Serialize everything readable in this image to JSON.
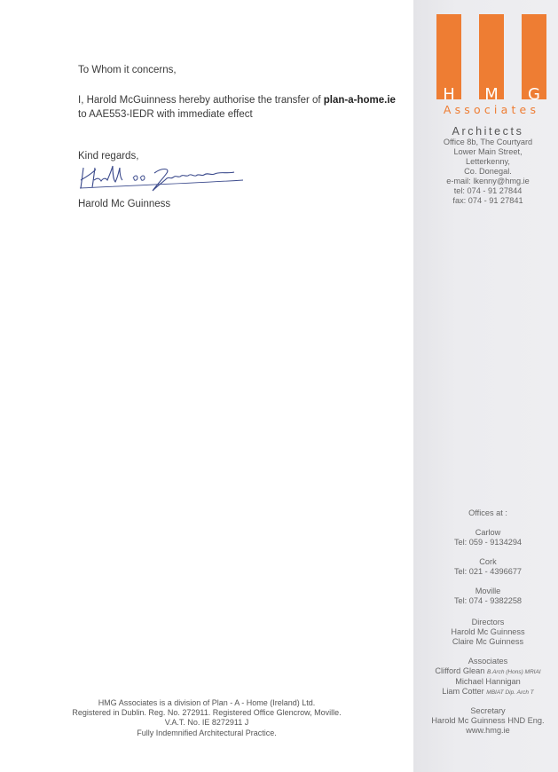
{
  "letter": {
    "greeting": "To Whom it concerns,",
    "line1_prefix": "I, Harold McGuinness hereby authorise the transfer of ",
    "line1_domain": "plan-a-home.ie",
    "line2": "to AAE553-IEDR with immediate effect",
    "closing": "Kind regards,",
    "signature_name": "Harold Mc Guinness"
  },
  "footer": {
    "lines": [
      "HMG Associates is a division of Plan - A - Home (Ireland) Ltd.",
      "Registered in Dublin. Reg. No. 272911. Registered Office Glencrow, Moville.",
      "V.A.T. No. IE 8272911 J",
      "Fully Indemnified Architectural Practice."
    ]
  },
  "logo": {
    "letters": [
      "H",
      "M",
      "G"
    ],
    "subtitle": "Associates",
    "brand_color": "#ee7d33"
  },
  "sidebar": {
    "title": "Architects",
    "address": [
      "Office 8b, The Courtyard",
      "Lower Main Street,",
      "Letterkenny,",
      "Co. Donegal."
    ],
    "email": "e-mail: lkenny@hmg.ie",
    "tel": "tel: 074 - 91 27844",
    "fax": "fax: 074 - 91 27841",
    "offices_heading": "Offices at :",
    "offices": [
      {
        "name": "Carlow",
        "tel": "Tel: 059 - 9134294"
      },
      {
        "name": "Cork",
        "tel": "Tel: 021 - 4396677"
      },
      {
        "name": "Moville",
        "tel": "Tel: 074 - 9382258"
      }
    ],
    "directors_heading": "Directors",
    "directors": [
      "Harold Mc Guinness",
      "Claire Mc Guinness"
    ],
    "associates_heading": "Associates",
    "associates": [
      {
        "name": "Clifford Glean",
        "quals": "B.Arch (Hons) MRIAI"
      },
      {
        "name": "Michael Hannigan",
        "quals": ""
      },
      {
        "name": "Liam Cotter",
        "quals": "MBIAT Dip. Arch T"
      }
    ],
    "secretary_heading": "Secretary",
    "secretary": "Harold Mc Guinness HND Eng.",
    "website": "www.hmg.ie"
  }
}
